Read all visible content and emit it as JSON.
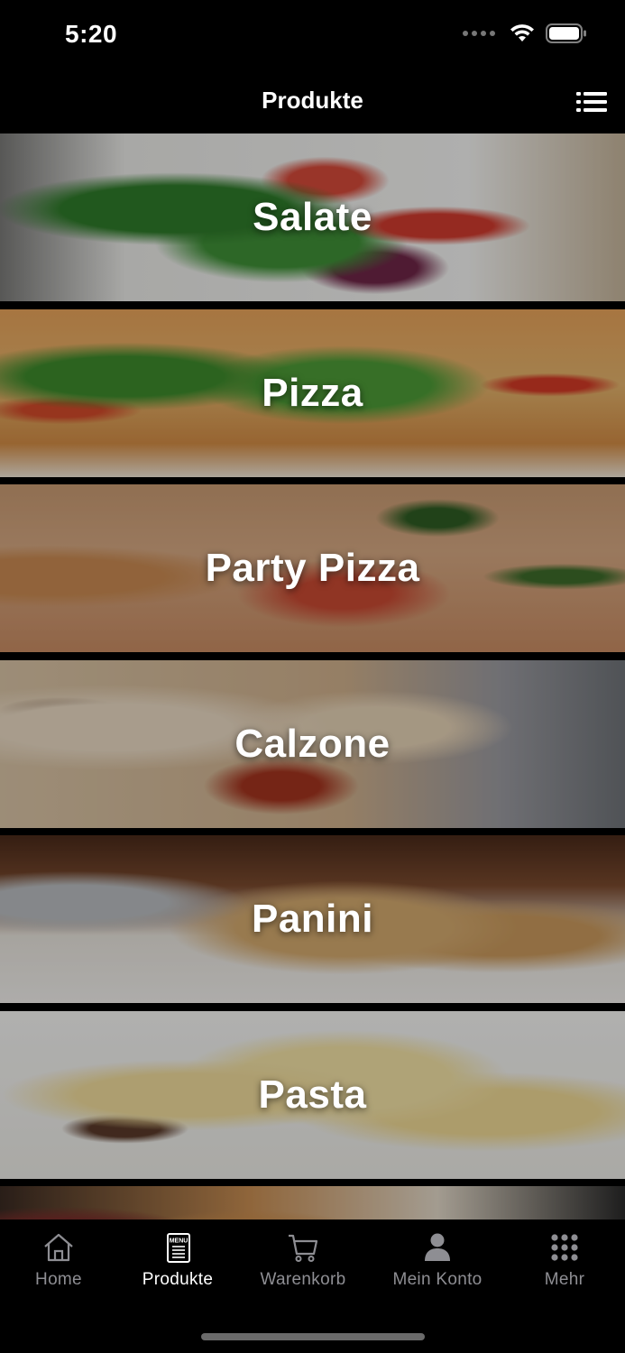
{
  "status_bar": {
    "time": "5:20"
  },
  "nav": {
    "title": "Produkte",
    "menu_icon": "list-icon"
  },
  "categories": [
    {
      "label": "Salate",
      "image": "salad-photo"
    },
    {
      "label": "Pizza",
      "image": "pizza-photo"
    },
    {
      "label": "Party Pizza",
      "image": "party-pizza-photo"
    },
    {
      "label": "Calzone",
      "image": "calzone-photo"
    },
    {
      "label": "Panini",
      "image": "panini-photo"
    },
    {
      "label": "Pasta",
      "image": "pasta-photo"
    },
    {
      "label": "",
      "image": "burger-photo"
    }
  ],
  "tab_bar": {
    "items": [
      {
        "label": "Home",
        "icon": "home-icon",
        "active": false
      },
      {
        "label": "Produkte",
        "icon": "menu-card-icon",
        "active": true
      },
      {
        "label": "Warenkorb",
        "icon": "cart-icon",
        "active": false
      },
      {
        "label": "Mein Konto",
        "icon": "person-icon",
        "active": false
      },
      {
        "label": "Mehr",
        "icon": "grid-dots-icon",
        "active": false
      }
    ],
    "menu_icon_text": "MENU"
  },
  "colors": {
    "background": "#000000",
    "active": "#ffffff",
    "inactive": "#8e8e93"
  }
}
